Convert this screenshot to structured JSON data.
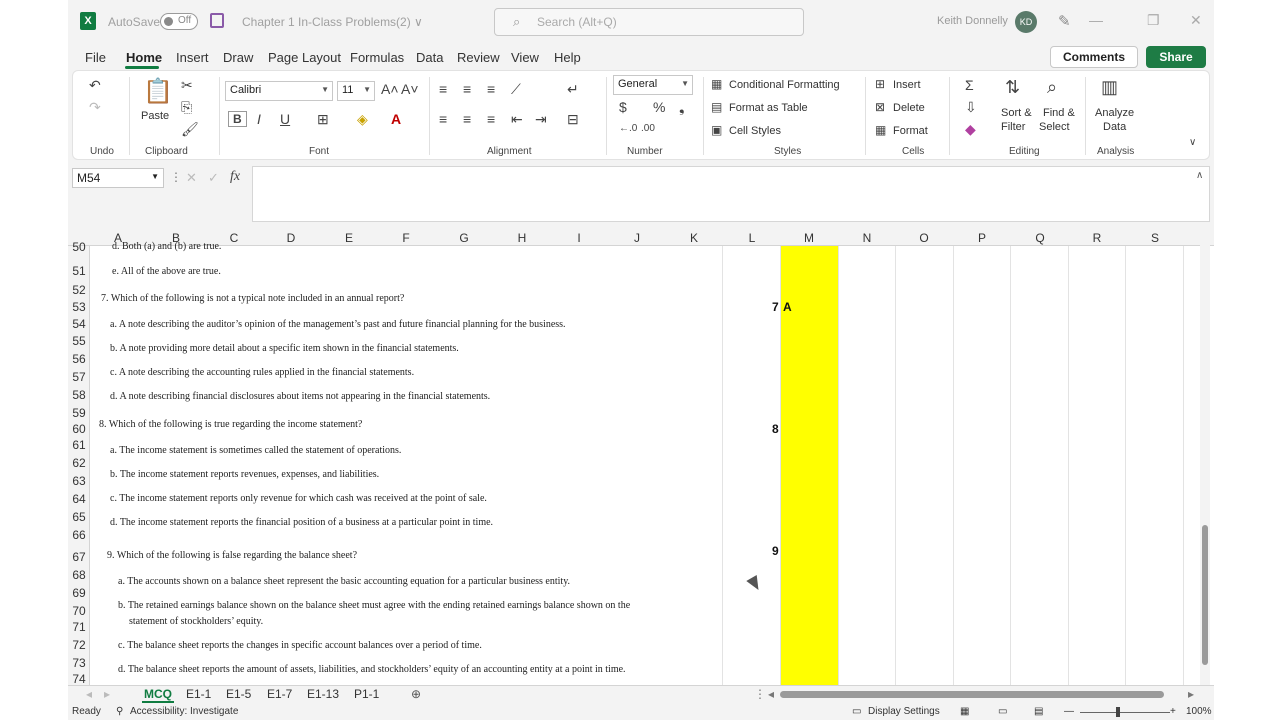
{
  "titlebar": {
    "autosave_label": "AutoSave",
    "autosave_state": "Off",
    "doc_title": "Chapter 1 In-Class Problems(2) ∨",
    "search_placeholder": "Search (Alt+Q)",
    "user_name": "Keith Donnelly",
    "user_initials": "KD"
  },
  "menu": {
    "tabs": [
      "File",
      "Home",
      "Insert",
      "Draw",
      "Page Layout",
      "Formulas",
      "Data",
      "Review",
      "View",
      "Help"
    ],
    "active": "Home",
    "comments_label": "Comments",
    "share_label": "Share"
  },
  "ribbon": {
    "groups": [
      "Undo",
      "Clipboard",
      "Font",
      "Alignment",
      "Number",
      "Styles",
      "Cells",
      "Editing",
      "Analysis"
    ],
    "paste_label": "Paste",
    "font_name": "Calibri",
    "font_size": "11",
    "number_format": "General",
    "conditional_formatting": "Conditional Formatting",
    "format_as_table": "Format as Table",
    "cell_styles": "Cell Styles",
    "insert": "Insert",
    "delete": "Delete",
    "format": "Format",
    "sort_filter": [
      "Sort &",
      "Filter"
    ],
    "find_select": [
      "Find &",
      "Select"
    ],
    "analyze_data": [
      "Analyze",
      "Data"
    ]
  },
  "formula_bar": {
    "name_box": "M54",
    "formula": ""
  },
  "grid": {
    "columns": [
      "A",
      "B",
      "C",
      "D",
      "E",
      "F",
      "G",
      "H",
      "I",
      "J",
      "K",
      "L",
      "M",
      "N",
      "O",
      "P",
      "Q",
      "R",
      "S"
    ],
    "rows": [
      "50",
      "51",
      "52",
      "53",
      "54",
      "55",
      "56",
      "57",
      "58",
      "59",
      "60",
      "61",
      "62",
      "63",
      "64",
      "65",
      "66",
      "67",
      "68",
      "69",
      "70",
      "71",
      "72",
      "73",
      "74"
    ],
    "questions": [
      "d. Both (a) and (b) are true.",
      "e. All of the above are true.",
      "7. Which of the following is not a typical note included in an annual report?",
      "a. A note describing the auditor’s opinion of the management’s past and future financial planning for the business.",
      "b. A note providing more detail about a specific item shown in the financial statements.",
      "c. A note describing the accounting rules applied in the financial statements.",
      "d. A note describing financial disclosures about items not appearing in the financial statements.",
      "8. Which of the following is true regarding the income statement?",
      "a. The income statement is sometimes called the statement of operations.",
      "b. The income statement reports revenues, expenses, and liabilities.",
      "c. The income statement reports only revenue for which cash was received at the point of sale.",
      "d. The income statement reports the financial position of a business at a particular point in time.",
      "9. Which of the following is false regarding the balance sheet?",
      "a. The accounts shown on a balance sheet represent the basic accounting equation for a particular business entity.",
      "b. The retained earnings balance shown on the balance sheet must agree with the ending retained earnings balance shown on the",
      "statement of stockholders’ equity.",
      "c. The balance sheet reports the changes in specific account balances over a period of time.",
      "d. The balance sheet reports the amount of assets, liabilities, and stockholders’ equity of an accounting entity at a point in time."
    ],
    "answer_cells": [
      {
        "number": "7",
        "answer": "A"
      },
      {
        "number": "8",
        "answer": ""
      },
      {
        "number": "9",
        "answer": ""
      }
    ],
    "highlight_color": "#ffff00"
  },
  "sheets": {
    "tabs": [
      "MCQ",
      "E1-1",
      "E1-5",
      "E1-7",
      "E1-13",
      "P1-1"
    ],
    "active": "MCQ"
  },
  "status": {
    "ready": "Ready",
    "accessibility": "Accessibility: Investigate",
    "display_settings": "Display Settings",
    "zoom": "100%"
  },
  "colors": {
    "excel_green": "#107c41",
    "share_green": "#1e7c45"
  }
}
